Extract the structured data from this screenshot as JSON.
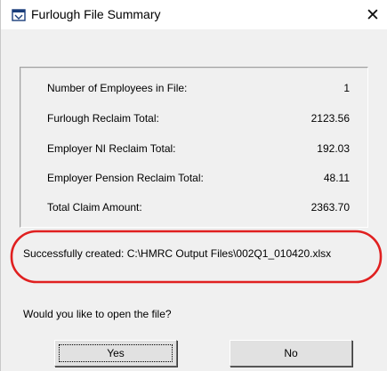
{
  "window": {
    "title": "Furlough File Summary",
    "close_glyph": "✕"
  },
  "summary": {
    "rows": [
      {
        "label": "Number of Employees in File:",
        "value": "1"
      },
      {
        "label": "Furlough Reclaim Total:",
        "value": "2123.56"
      },
      {
        "label": "Employer NI Reclaim Total:",
        "value": "192.03"
      },
      {
        "label": "Employer Pension Reclaim Total:",
        "value": "48.11"
      },
      {
        "label": "Total Claim Amount:",
        "value": "2363.70"
      }
    ]
  },
  "status": {
    "message": "Successfully created: C:\\HMRC Output Files\\002Q1_010420.xlsx"
  },
  "prompt": {
    "question": "Would you like to open the file?"
  },
  "buttons": {
    "yes_label": "Yes",
    "no_label": "No"
  },
  "colors": {
    "highlight_oval": "#e02020",
    "dialog_background": "#f0f0f0",
    "button_face": "#e1e1e1"
  },
  "icons": {
    "title": "app-window-icon",
    "close": "close-icon"
  }
}
